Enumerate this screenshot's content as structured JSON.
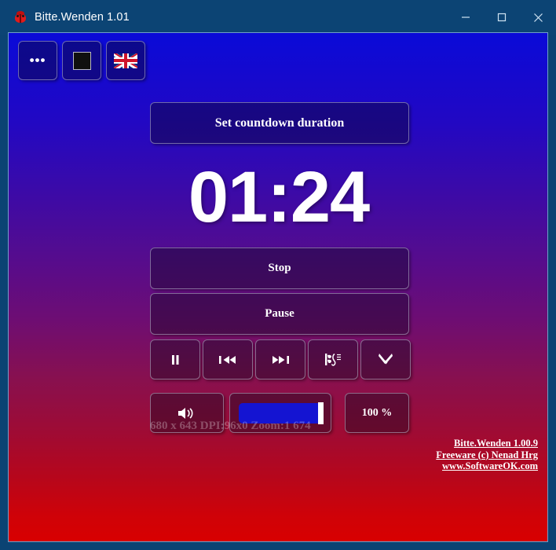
{
  "window": {
    "title": "Bitte.Wenden 1.01",
    "icon": "bug-icon",
    "controls": {
      "minimize": "minimize-icon",
      "maximize": "maximize-icon",
      "close": "close-icon"
    }
  },
  "toolbar": {
    "buttons": [
      {
        "name": "more-options-button",
        "label": "•••",
        "icon": "ellipsis-icon"
      },
      {
        "name": "display-mode-button",
        "label": "",
        "icon": "black-square-icon"
      },
      {
        "name": "language-button",
        "label": "",
        "icon": "union-jack-flag-icon"
      }
    ]
  },
  "main": {
    "set_duration_label": "Set countdown duration",
    "countdown": "01:24",
    "stop_label": "Stop",
    "pause_label": "Pause",
    "media_buttons": [
      {
        "name": "pause-icon-button",
        "icon": "pause-icon"
      },
      {
        "name": "previous-track-button",
        "icon": "skip-backward-icon"
      },
      {
        "name": "next-track-button",
        "icon": "skip-forward-icon"
      },
      {
        "name": "sound-select-button",
        "icon": "music-note-icon"
      },
      {
        "name": "settings-button",
        "icon": "tools-icon"
      }
    ],
    "volume": {
      "speaker_icon": "speaker-icon",
      "percent_label": "100 %",
      "value": 100
    },
    "status_text": "680 x 643 DPI:96x0 Zoom:1 674"
  },
  "footer": {
    "links": [
      {
        "name": "product-version-link",
        "text": "Bitte.Wenden 1.00.9"
      },
      {
        "name": "freeware-author-link",
        "text": "Freeware (c) Nenad Hrg"
      },
      {
        "name": "website-link",
        "text": "www.SoftwareOK.com"
      }
    ]
  },
  "colors": {
    "titlebar": "#0c4474",
    "gradient_top": "#0a0ad8",
    "gradient_bottom": "#d80000",
    "slider_fill": "#1414d2",
    "accent_text": "#ffffff"
  }
}
